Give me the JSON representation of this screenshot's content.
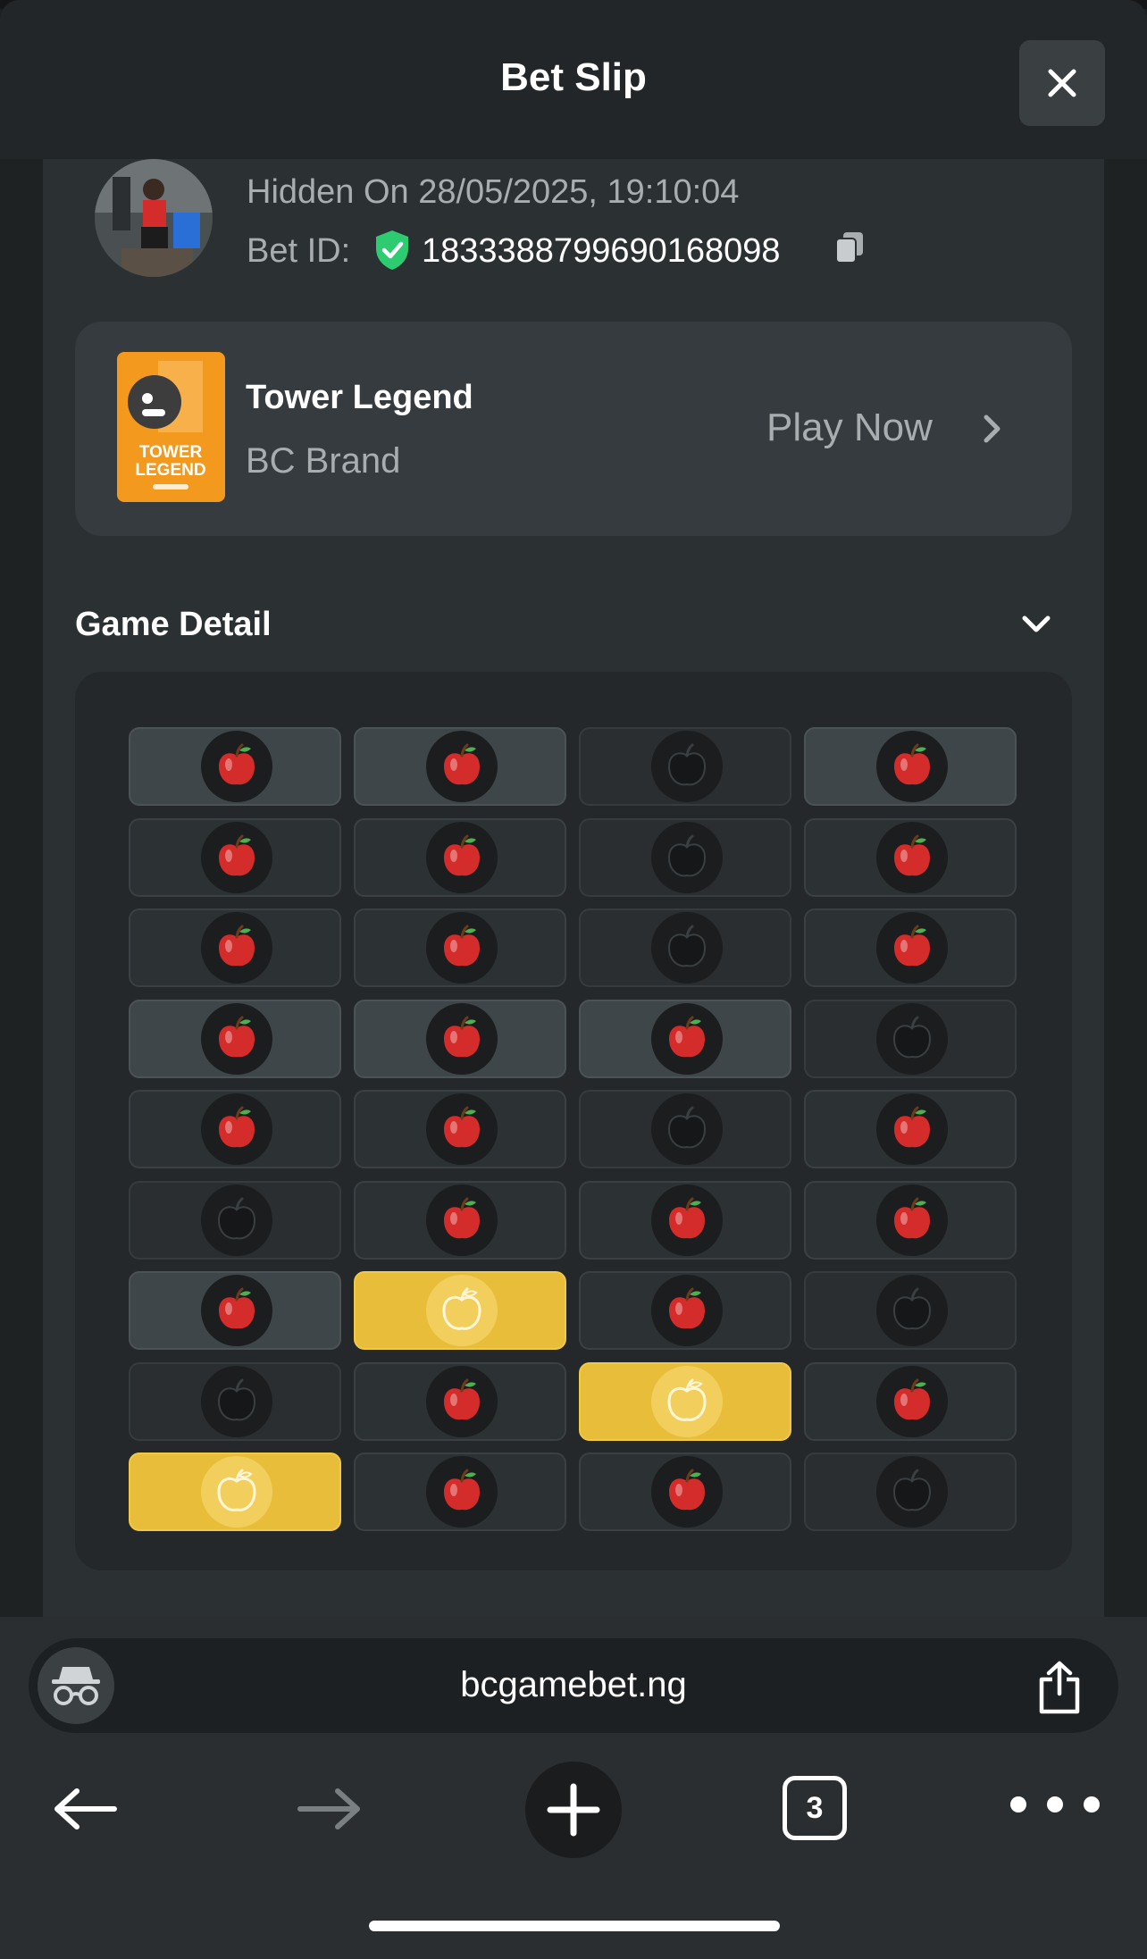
{
  "header": {
    "title": "Bet Slip"
  },
  "bet": {
    "hidden_on": "Hidden On 28/05/2025, 19:10:04",
    "bet_id_label": "Bet ID:",
    "bet_id": "1833388799690168098"
  },
  "game": {
    "name": "Tower Legend",
    "provider": "BC Brand",
    "thumbnail_text_line1": "TOWER",
    "thumbnail_text_line2": "LEGEND",
    "play_label": "Play Now"
  },
  "detail": {
    "title": "Game Detail",
    "rows": [
      [
        "light",
        "light",
        "dim",
        "light"
      ],
      [
        "dark",
        "dark",
        "dim",
        "dark"
      ],
      [
        "dark",
        "dark",
        "dim",
        "dark"
      ],
      [
        "light",
        "light",
        "light",
        "dim"
      ],
      [
        "dark",
        "dark",
        "dim",
        "dark"
      ],
      [
        "dim",
        "dark",
        "dark",
        "dark"
      ],
      [
        "light",
        "gold",
        "dark",
        "dim"
      ],
      [
        "dim",
        "dark",
        "gold",
        "dark"
      ],
      [
        "gold",
        "dark",
        "dark",
        "dim"
      ]
    ]
  },
  "browser": {
    "url": "bcgamebet.ng",
    "tab_count": "3"
  },
  "colors": {
    "gold": "#e7bd3a",
    "apple_red": "#d42b2b",
    "shield_green": "#2ecc71"
  }
}
